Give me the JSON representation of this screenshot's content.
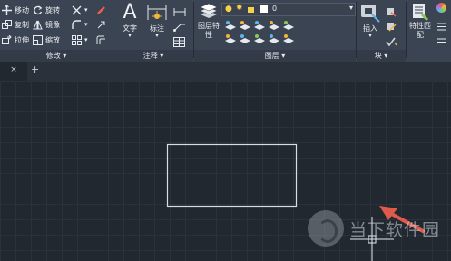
{
  "modify_panel": {
    "move": "移动",
    "rotate": "旋转",
    "trim": "修剪",
    "copy": "复制",
    "mirror": "镜像",
    "fillet": "圆角",
    "stretch": "拉伸",
    "scale": "缩放",
    "array": "阵列",
    "title": "修改"
  },
  "annotation_panel": {
    "text": "文字",
    "dimension": "标注",
    "title": "注释"
  },
  "layers_panel": {
    "layer_properties": "图层特性",
    "current_layer": "0",
    "title": "图层"
  },
  "block_panel": {
    "insert": "插入",
    "title": "块"
  },
  "properties_panel": {
    "match": "特性匹配"
  },
  "tabs": {
    "close": "×",
    "new": "+"
  },
  "watermark": {
    "text": "当下软件园"
  },
  "colors": {
    "accent": "#e05a4c",
    "canvas_bg": "#212830",
    "ribbon_bg": "#3b4453"
  }
}
